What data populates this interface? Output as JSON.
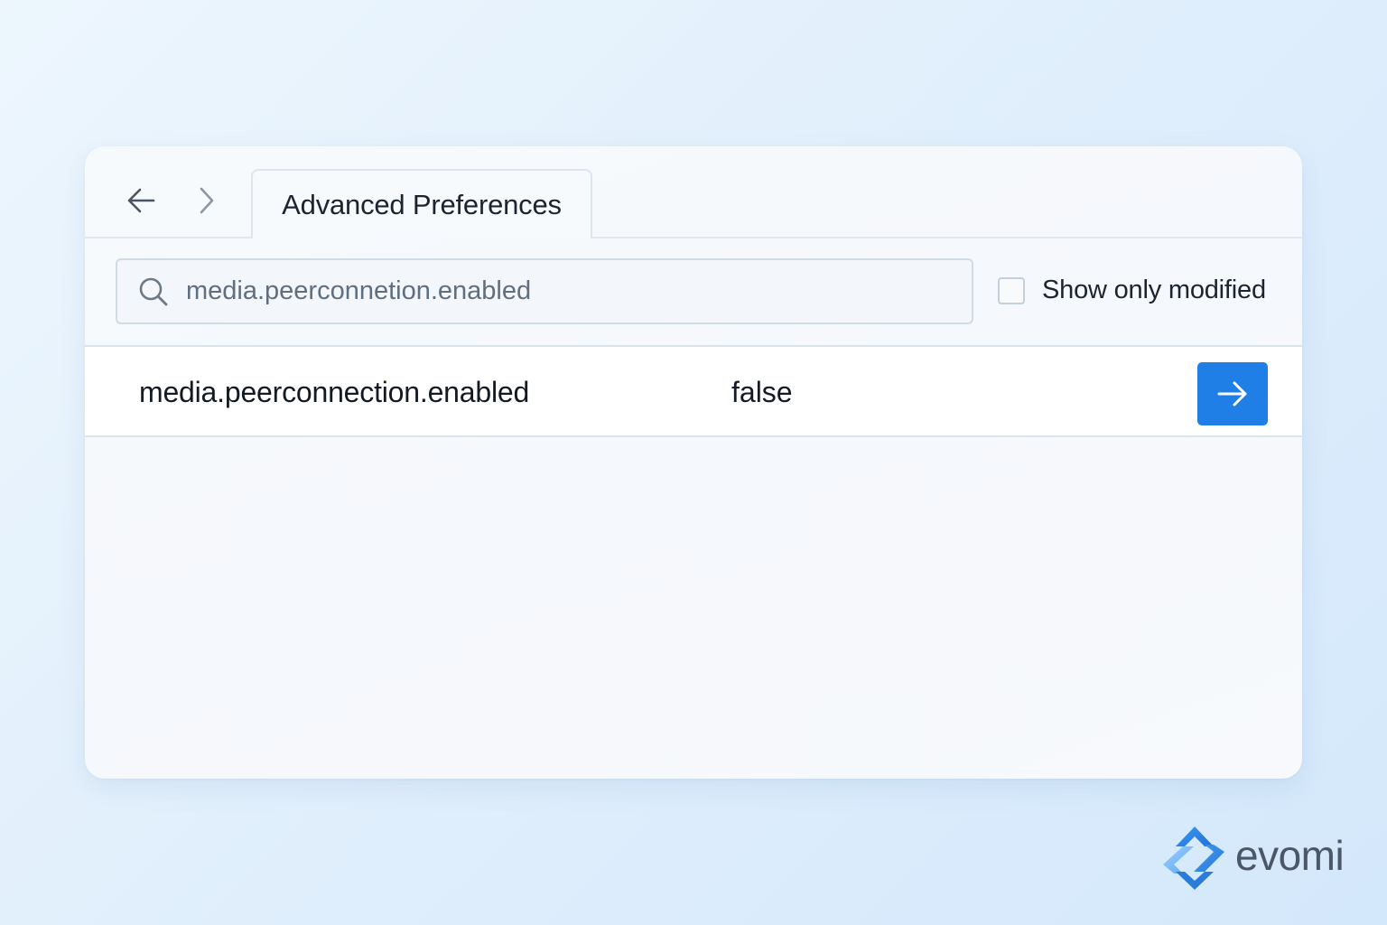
{
  "window": {
    "tab_title": "Advanced Preferences"
  },
  "search": {
    "value": "media.peerconnetion.enabled"
  },
  "filter": {
    "label": "Show only modified",
    "checked": false
  },
  "results": [
    {
      "name": "media.peerconnection.enabled",
      "value": "false"
    }
  ],
  "brand": {
    "name": "evomi"
  },
  "colors": {
    "accent": "#1f7fe6",
    "brand_blue": "#2b7bd8"
  },
  "icons": {
    "back": "arrow-left-icon",
    "forward": "chevron-right-icon",
    "search": "search-icon",
    "go": "arrow-right-icon",
    "logo": "evomi-logo-icon"
  }
}
